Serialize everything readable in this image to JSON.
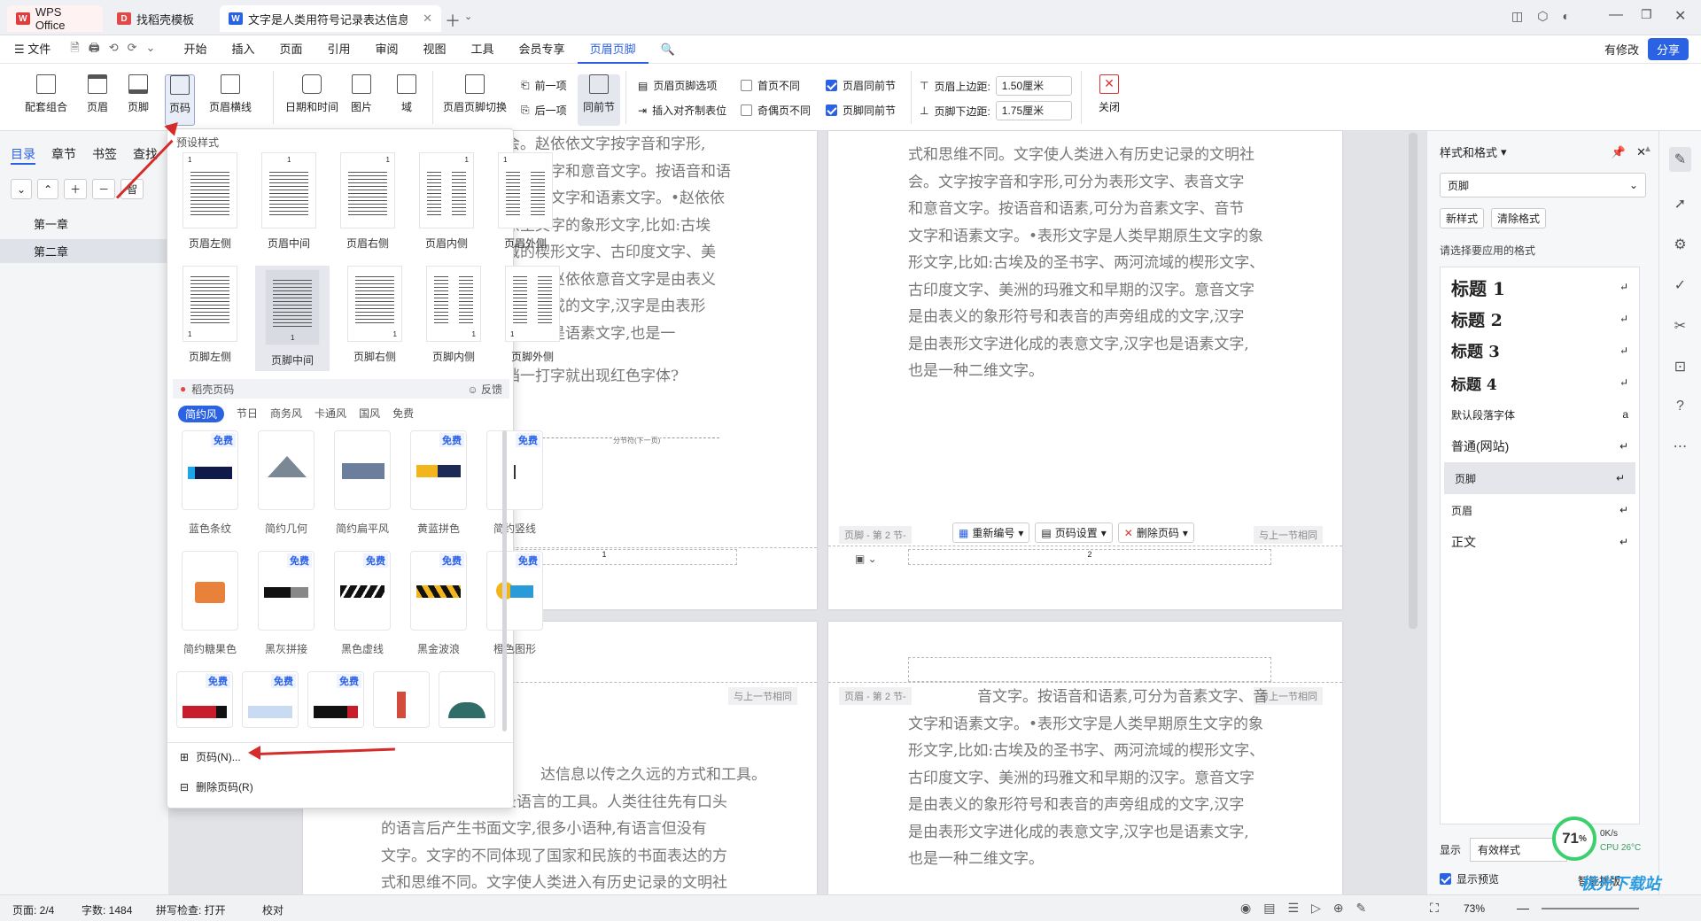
{
  "tabs": [
    {
      "label": "WPS Office"
    },
    {
      "label": "找稻壳模板"
    },
    {
      "label": "文字是人类用符号记录表达信息以"
    }
  ],
  "menu": [
    "文件",
    "开始",
    "插入",
    "页面",
    "引用",
    "审阅",
    "视图",
    "工具",
    "会员专享",
    "页眉页脚"
  ],
  "menu_right": {
    "modified": "有修改",
    "share": "分享"
  },
  "ribbon": {
    "combo": "配套组合",
    "header": "页眉",
    "footer": "页脚",
    "pagenum": "页码",
    "headerline": "页眉横线",
    "datetime": "日期和时间",
    "picture": "图片",
    "field": "域",
    "switch": "页眉页脚切换",
    "prev": "前一项",
    "next": "后一项",
    "same": "同前节",
    "options": "页眉页脚选项",
    "align_tab": "插入对齐制表位",
    "first_diff": "首页不同",
    "oddeven_diff": "奇偶页不同",
    "header_same": "页眉同前节",
    "footer_same": "页脚同前节",
    "top_margin_label": "页眉上边距:",
    "top_margin": "1.50厘米",
    "bottom_margin_label": "页脚下边距:",
    "bottom_margin": "1.75厘米",
    "close": "关闭"
  },
  "leftpanel": {
    "tabs": [
      "目录",
      "章节",
      "书签",
      "查找"
    ],
    "items": [
      "第一章",
      "第二章"
    ],
    "smart": "智"
  },
  "dropdown": {
    "preset_title": "预设样式",
    "header_styles": [
      "页眉左侧",
      "页眉中间",
      "页眉右侧",
      "页眉内侧",
      "页眉外侧"
    ],
    "footer_styles": [
      "页脚左侧",
      "页脚中间",
      "页脚右侧",
      "页脚内侧",
      "页脚外侧"
    ],
    "daoke_title": "稻壳页码",
    "feedback": "反馈",
    "filters": [
      "简约风",
      "节日",
      "商务风",
      "卡通风",
      "国风",
      "免费"
    ],
    "free_tag": "免费",
    "cards_row1": [
      "蓝色条纹",
      "简约几何",
      "简约扁平风",
      "黄蓝拼色",
      "简约竖线"
    ],
    "cards_row2": [
      "简约糖果色",
      "黑灰拼接",
      "黑色虚线",
      "黑金波浪",
      "橙色图形"
    ],
    "pagenum_item": "页码(N)...",
    "delete_item": "删除页码(R)"
  },
  "doc": {
    "p1_lines": [
      "会。赵依依文字按字音和字形,",
      "表音文字和意音文字。按语音和语",
      "、音节文字和语素文字。•赵依依",
      "原生文字的象形文字,比如:古埃",
      "域的楔形文字、古印度文字、美",
      "汉字。赵依依意音文字是由表义",
      "声旁组成的文字,汉字是由表形",
      "汉字也是语素文字,也是一"
    ],
    "p1_question": "档一打字就出现红色字体?",
    "section_break": "分节符(下一页)",
    "p2_lines": [
      "式和思维不同。文字使人类进入有历史记录的文明社",
      "会。文字按字音和字形,可分为表形文字、表音文字",
      "和意音文字。按语音和语素,可分为音素文字、音节",
      "文字和语素文字。•表形文字是人类早期原生文字的象",
      "形文字,比如:古埃及的圣书字、两河流域的楔形文字、",
      "古印度文字、美洲的玛雅文和早期的汉字。意音文字",
      "是由表义的象形符号和表音的声旁组成的文字,汉字",
      "是由表形文字进化成的表意文字,汉字也是语素文字,",
      "也是一种二维文字。"
    ],
    "footer_tag": "页脚 - 第 2 节-",
    "header_tag": "页眉 - 第 2 节-",
    "same_prev": "与上一节相同",
    "renumber": "重新编号",
    "pageset": "页码设置",
    "delpage": "删除页码",
    "pn1": "1",
    "pn2": "2",
    "p3_lines": [
      "达信息以传之久远的方式和工具。",
      "现代文字大多是记录语言的工具。人类往往先有口头",
      "的语言后产生书面文字,很多小语种,有语言但没有",
      "文字。文字的不同体现了国家和民族的书面表达的方",
      "式和思维不同。文字使人类进入有历史记录的文明社"
    ],
    "p4_lines": [
      "音文字。按语音和语素,可分为音素文字、音",
      "文字和语素文字。•表形文字是人类早期原生文字的象",
      "形文字,比如:古埃及的圣书字、两河流域的楔形文字、",
      "古印度文字、美洲的玛雅文和早期的汉字。意音文字",
      "是由表义的象形符号和表音的声旁组成的文字,汉字",
      "是由表形文字进化成的表意文字,汉字也是语素文字,",
      "也是一种二维文字。"
    ]
  },
  "rightpanel": {
    "title": "样式和格式",
    "current": "页脚",
    "new_style": "新样式",
    "clear_format": "清除格式",
    "prompt": "请选择要应用的格式",
    "styles": [
      "标题 1",
      "标题 2",
      "标题 3",
      "标题 4",
      "默认段落字体",
      "普通(网站)",
      "页脚",
      "页眉",
      "正文"
    ],
    "show_label": "显示",
    "show_value": "有效样式",
    "preview": "显示预览",
    "smart": "智能排版"
  },
  "perf": {
    "percent": "71",
    "net": "0K/s",
    "cpu": "CPU 26°C"
  },
  "statusbar": {
    "page": "页面: 2/4",
    "words": "字数: 1484",
    "spell": "拼写检查: 打开",
    "proof": "校对",
    "zoom": "73%"
  },
  "watermark": "极光下载站"
}
